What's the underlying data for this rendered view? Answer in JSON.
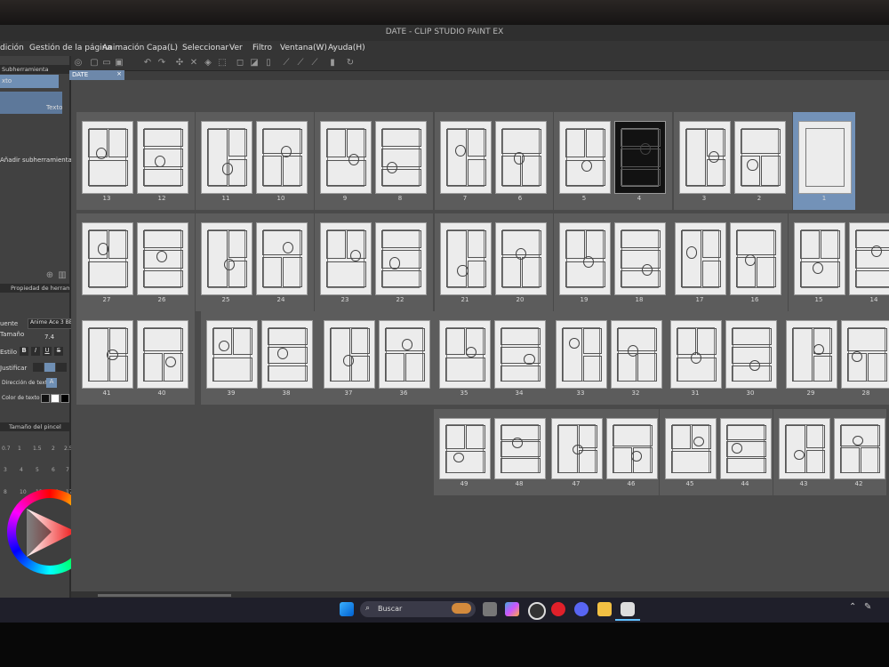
{
  "window": {
    "title": "DATE - CLIP STUDIO PAINT EX"
  },
  "menu": [
    "dición",
    "Gestión de la página",
    "Animación",
    "Capa(L)",
    "Seleccionar",
    "Ver",
    "Filtro",
    "Ventana(W)",
    "Ayuda(H)"
  ],
  "tab": {
    "label": "DATE",
    "close": "×"
  },
  "left_panel": {
    "subtool_header": "Subherramienta",
    "subtool_item_1": "xto",
    "subtool_item_2": "Texto",
    "add_subtool": "Añadir subherramienta",
    "tool_property_header": "Propiedad de herram. [Tex",
    "font_label": "uente",
    "font_value": "Anime Ace 3 BB",
    "size_label": "Tamaño",
    "size_value": "7.4",
    "style_label": "Estilo",
    "style_buttons": [
      "B",
      "I",
      "U",
      "S"
    ],
    "justify_label": "Justificar",
    "direction_label": "Dirección de texto",
    "direction_value": "A",
    "color_label": "Color de texto",
    "brush_size_header": "Tamaño del pincel",
    "brush_sizes": [
      "0.7",
      "1",
      "1.5",
      "2",
      "2.5",
      "3",
      "4",
      "5",
      "6",
      "7",
      "8",
      "10",
      "12",
      "15",
      "17"
    ]
  },
  "pages": {
    "row1": [
      [
        "13",
        "12"
      ],
      [
        "11",
        "10"
      ],
      [
        "9",
        "8"
      ],
      [
        "7",
        "6"
      ],
      [
        "5",
        "4"
      ],
      [
        "3",
        "2"
      ],
      [
        "",
        "1"
      ]
    ],
    "row2": [
      [
        "27",
        "26"
      ],
      [
        "25",
        "24"
      ],
      [
        "23",
        "22"
      ],
      [
        "21",
        "20"
      ],
      [
        "19",
        "18"
      ],
      [
        "17",
        "16"
      ],
      [
        "15",
        "14"
      ]
    ],
    "row3": [
      [
        "41",
        "40"
      ],
      [
        "39",
        "38"
      ],
      [
        "37",
        "36"
      ],
      [
        "35",
        "34"
      ],
      [
        "33",
        "32"
      ],
      [
        "31",
        "30"
      ],
      [
        "29",
        "28"
      ]
    ],
    "row4": [
      [
        "49",
        "48"
      ],
      [
        "47",
        "46"
      ],
      [
        "45",
        "44"
      ],
      [
        "43",
        "42"
      ]
    ]
  },
  "taskbar": {
    "search_placeholder": "Buscar"
  },
  "colors": {
    "selection": "#7392b8",
    "tab": "#6d88aa"
  }
}
